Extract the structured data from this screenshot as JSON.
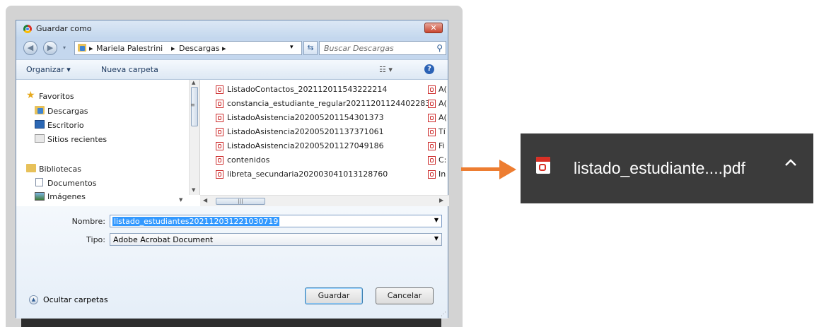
{
  "dialog": {
    "title": "Guardar como",
    "close_label": "✕",
    "breadcrumb": [
      "Mariela Palestrini",
      "Descargas"
    ],
    "search_placeholder": "Buscar Descargas",
    "toolbar": {
      "organize": "Organizar ▾",
      "new_folder": "Nueva carpeta"
    },
    "nav_items": {
      "favorites": "Favoritos",
      "downloads": "Descargas",
      "desktop": "Escritorio",
      "recent": "Sitios recientes",
      "libraries": "Bibliotecas",
      "documents": "Documentos",
      "images": "Imágenes"
    },
    "files_col1": [
      "ListadoContactos_202112011543222214",
      "constancia_estudiante_regular202112011244022831",
      "ListadoAsistencia202005201154301373",
      "ListadoAsistencia202005201137371061",
      "ListadoAsistencia202005201127049186",
      "contenidos",
      "libreta_secundaria202003041013128760"
    ],
    "files_col2": [
      "A(",
      "A(",
      "A(",
      "Tí",
      "Fi",
      "C:",
      "In"
    ],
    "form": {
      "name_label": "Nombre:",
      "name_value": "listado_estudiantes202112031221030719",
      "type_label": "Tipo:",
      "type_value": "Adobe Acrobat Document"
    },
    "hide_folders": "Ocultar carpetas",
    "save_button": "Guardar",
    "cancel_button": "Cancelar"
  },
  "download_bar": {
    "filename": "listado_estudiante....pdf"
  },
  "colors": {
    "arrow": "#ed7d31",
    "download_bar_bg": "#3b3b3b",
    "selection": "#3399ff"
  }
}
